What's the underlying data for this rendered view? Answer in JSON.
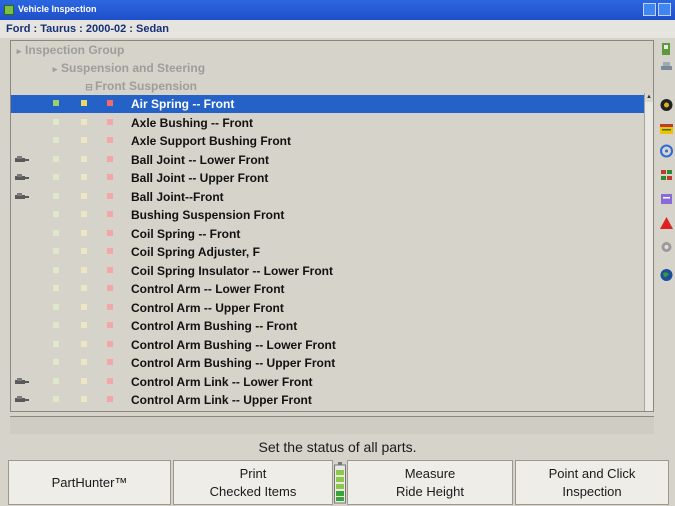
{
  "window": {
    "title": "Vehicle Inspection"
  },
  "vehicle": {
    "label": "Ford : Taurus : 2000-02 : Sedan"
  },
  "tree": {
    "group": "Inspection Group",
    "subgroup": "Suspension and Steering",
    "category": "Front Suspension"
  },
  "items": [
    {
      "label": "Air Spring -- Front",
      "selected": true,
      "car": false
    },
    {
      "label": "Axle Bushing -- Front",
      "selected": false,
      "car": false
    },
    {
      "label": "Axle Support Bushing Front",
      "selected": false,
      "car": false
    },
    {
      "label": "Ball Joint -- Lower Front",
      "selected": false,
      "car": true
    },
    {
      "label": "Ball Joint -- Upper Front",
      "selected": false,
      "car": true
    },
    {
      "label": "Ball Joint--Front",
      "selected": false,
      "car": true
    },
    {
      "label": "Bushing Suspension Front",
      "selected": false,
      "car": false
    },
    {
      "label": "Coil Spring -- Front",
      "selected": false,
      "car": false
    },
    {
      "label": "Coil Spring Adjuster, F",
      "selected": false,
      "car": false
    },
    {
      "label": "Coil Spring Insulator -- Lower Front",
      "selected": false,
      "car": false
    },
    {
      "label": "Control Arm -- Lower Front",
      "selected": false,
      "car": false
    },
    {
      "label": "Control Arm -- Upper Front",
      "selected": false,
      "car": false
    },
    {
      "label": "Control Arm Bushing -- Front",
      "selected": false,
      "car": false
    },
    {
      "label": "Control Arm Bushing -- Lower Front",
      "selected": false,
      "car": false
    },
    {
      "label": "Control Arm Bushing -- Upper Front",
      "selected": false,
      "car": false
    },
    {
      "label": "Control Arm Link -- Lower Front",
      "selected": false,
      "car": true
    },
    {
      "label": "Control Arm Link -- Upper Front",
      "selected": false,
      "car": true
    }
  ],
  "status_message": "Set the status of all parts.",
  "buttons": {
    "parthunter": "PartHunter™",
    "print_line1": "Print",
    "print_line2": "Checked Items",
    "measure_line1": "Measure",
    "measure_line2": "Ride Height",
    "point_line1": "Point and Click",
    "point_line2": "Inspection"
  },
  "colors": {
    "selection": "#2462c8",
    "titlebar": "#2c67e0",
    "status_good": "#b9e08a",
    "status_suggested": "#f0e08a",
    "status_required": "#f08a8a",
    "vehicle_text": "#16307a"
  },
  "sidebar_icons": [
    "wrench-icon",
    "car-lift-icon",
    "tire-icon",
    "report-icon",
    "target-icon",
    "flag-icon",
    "note-icon",
    "warning-icon",
    "settings-icon",
    "globe-icon"
  ]
}
